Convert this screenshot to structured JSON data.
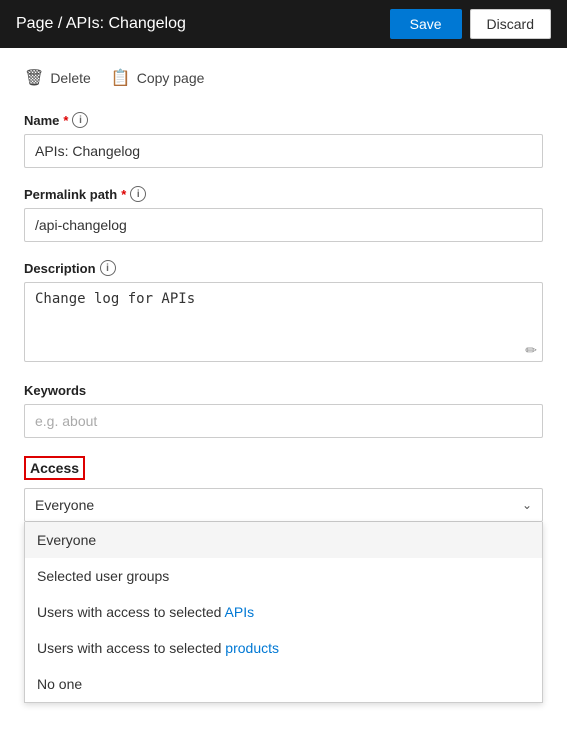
{
  "header": {
    "title": "Page / APIs: Changelog",
    "save_label": "Save",
    "discard_label": "Discard"
  },
  "toolbar": {
    "delete_label": "Delete",
    "copy_page_label": "Copy page"
  },
  "form": {
    "name_label": "Name",
    "name_required": "*",
    "name_value": "APIs: Changelog",
    "permalink_label": "Permalink path",
    "permalink_required": "*",
    "permalink_value": "/api-changelog",
    "description_label": "Description",
    "description_value": "Change log for APIs",
    "description_link_text": "APIs",
    "keywords_label": "Keywords",
    "keywords_placeholder": "e.g. about",
    "keywords_value": ""
  },
  "access": {
    "label": "Access",
    "selected": "Everyone",
    "options": [
      {
        "text": "Everyone",
        "selected": true
      },
      {
        "text": "Selected user groups",
        "selected": false
      },
      {
        "text": "Users with access to selected APIs",
        "selected": false,
        "has_link": true,
        "link_word": "APIs"
      },
      {
        "text": "Users with access to selected products",
        "selected": false,
        "has_link": true,
        "link_word": "products"
      },
      {
        "text": "No one",
        "selected": false
      }
    ]
  },
  "icons": {
    "delete": "🗑",
    "copy": "📋",
    "info": "i",
    "chevron_down": "⌄",
    "edit": "✏"
  }
}
